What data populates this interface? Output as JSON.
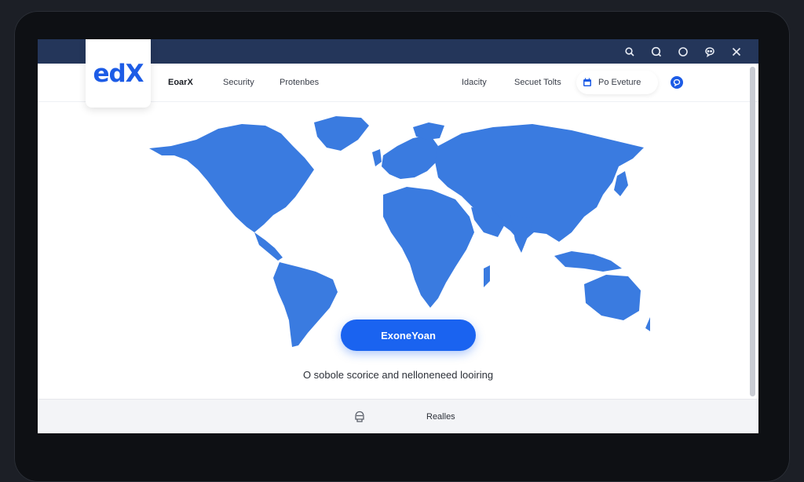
{
  "app": {
    "logo_text": "edX",
    "accent_color": "#1a63f0",
    "titlebar_color": "#24365a"
  },
  "titlebar": {
    "icons": [
      "search-icon",
      "zoom-icon",
      "circle-icon",
      "chat-icon",
      "close-icon"
    ]
  },
  "nav": {
    "brand": "EoarX",
    "links": [
      "Security",
      "Protenbes"
    ],
    "right_links": [
      "Idacity",
      "Secuet Tolts"
    ],
    "pill_label": "Po Eveture",
    "pill_icon": "calendar-icon",
    "chat_icon": "chat-bubble-icon"
  },
  "hero": {
    "map_icon": "world-map",
    "cta_label": "ExoneYoan",
    "tagline": "O sobole scorice and nelloneneed looiring"
  },
  "footer": {
    "icon": "helmet-icon",
    "label": "Realles"
  }
}
